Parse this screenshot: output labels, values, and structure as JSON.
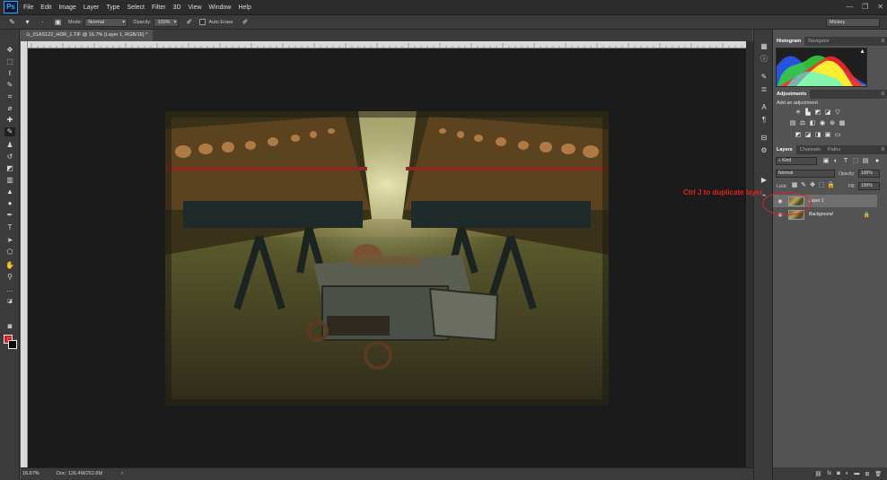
{
  "app": {
    "logo": "Ps"
  },
  "menu": [
    "File",
    "Edit",
    "Image",
    "Layer",
    "Type",
    "Select",
    "Filter",
    "3D",
    "View",
    "Window",
    "Help"
  ],
  "window_controls": [
    "—",
    "❐",
    "✕"
  ],
  "options": {
    "mode_label": "Mode:",
    "mode_value": "Normal",
    "opacity_label": "Opacity:",
    "opacity_value": "100%",
    "auto_erase_label": "Auto Erase",
    "workspace": "Mickey"
  },
  "document": {
    "tab_title": "⊙_01AS122_HDR_1.TIF @ 16.7% (Layer 1, RGB/16) *",
    "zoom": "16.67%",
    "info": "Doc: 126.4M/252.8M",
    "status_arrow": "›"
  },
  "panels": {
    "histogram_tabs": [
      "Histogram",
      "Navigator"
    ],
    "histogram_warning": "▲",
    "adjustments_tab": "Adjustments",
    "adjustments_title": "Add an adjustment",
    "layers_tabs": [
      "Layers",
      "Channels",
      "Paths"
    ],
    "filter_kind": "Kind",
    "blend_mode": "Normal",
    "opacity_label": "Opacity:",
    "opacity_value": "100%",
    "lock_label": "Lock:",
    "fill_label": "Fill:",
    "fill_value": "100%",
    "panel_menu": "≡"
  },
  "layers": [
    {
      "name": "Layer 1",
      "selected": true,
      "visible": true
    },
    {
      "name": "Background",
      "selected": false,
      "visible": true,
      "locked": true
    }
  ],
  "annotation": {
    "text": "Ctrl J to duplicate layer"
  },
  "colors": {
    "foreground": "#e6141c",
    "background": "#000000",
    "annotation": "#e12222"
  }
}
